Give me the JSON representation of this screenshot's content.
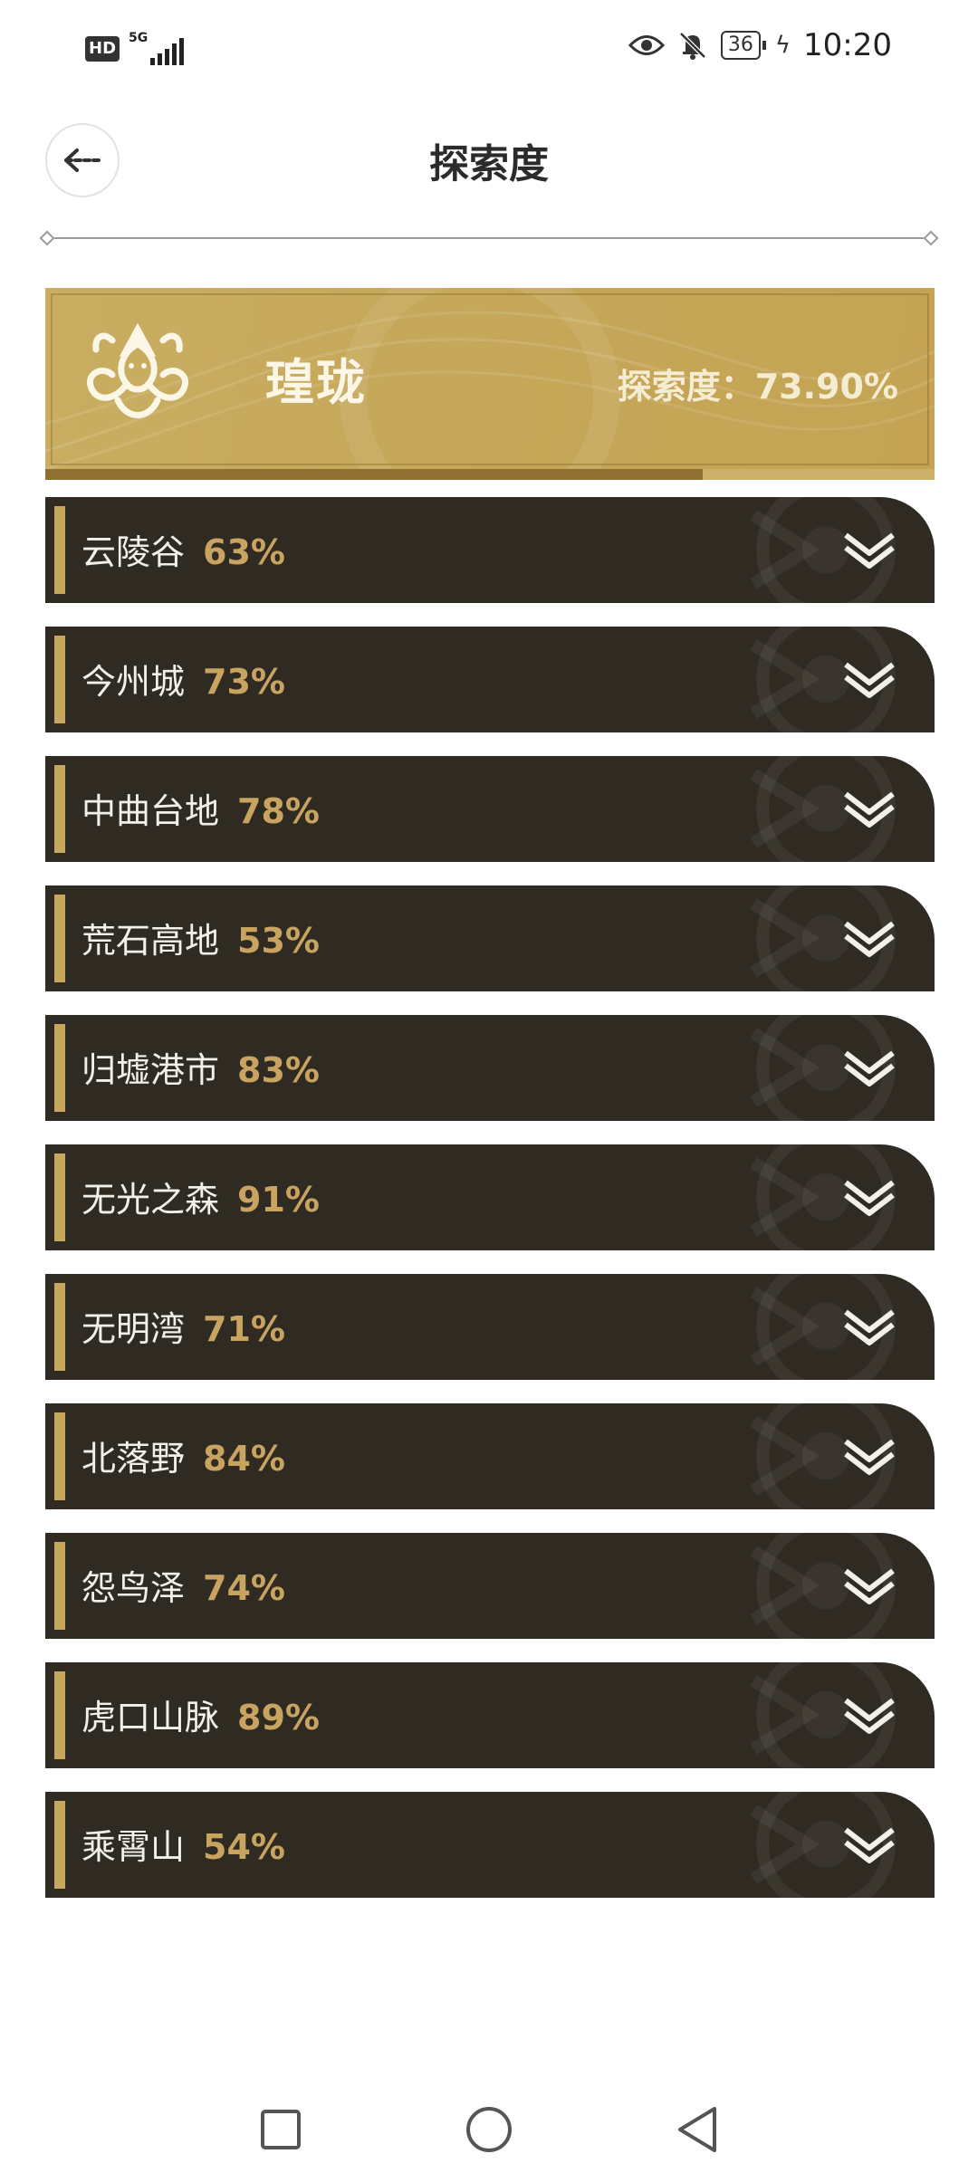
{
  "status_bar": {
    "hd": "HD",
    "network": "5G",
    "battery": "36",
    "time": "10:20",
    "icons": [
      "eye-icon",
      "bell-off-icon",
      "battery-icon",
      "charging-icon"
    ]
  },
  "header": {
    "title": "探索度",
    "back_icon": "back-arrow-icon"
  },
  "region": {
    "name": "瑝珑",
    "exploration_label": "探索度：73.90%",
    "progress": 0.739,
    "emblem_icon": "dragon-emblem-icon",
    "colors": {
      "accent": "#c9ae62",
      "fill": "#8f6f32"
    }
  },
  "subregions": [
    {
      "name": "云陵谷",
      "percent": "63%"
    },
    {
      "name": "今州城",
      "percent": "73%"
    },
    {
      "name": "中曲台地",
      "percent": "78%"
    },
    {
      "name": "荒石高地",
      "percent": "53%"
    },
    {
      "name": "归墟港市",
      "percent": "83%"
    },
    {
      "name": "无光之森",
      "percent": "91%"
    },
    {
      "name": "无明湾",
      "percent": "71%"
    },
    {
      "name": "北落野",
      "percent": "84%"
    },
    {
      "name": "怨鸟泽",
      "percent": "74%"
    },
    {
      "name": "虎口山脉",
      "percent": "89%"
    },
    {
      "name": "乘霄山",
      "percent": "54%"
    }
  ],
  "list_colors": {
    "row_bg": "#2f2b23",
    "percent": "#c9a461",
    "accent": "#c7a75f"
  },
  "nav": [
    "square-recents-icon",
    "circle-home-icon",
    "triangle-back-icon"
  ]
}
